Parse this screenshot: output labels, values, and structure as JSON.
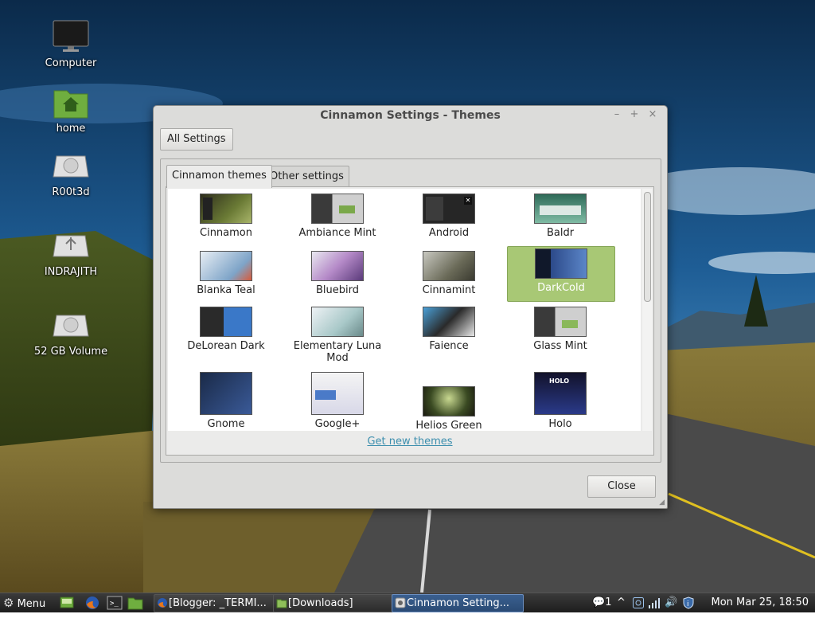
{
  "desktop": {
    "icons": [
      {
        "label": "Computer",
        "icon": "monitor-icon"
      },
      {
        "label": "home",
        "icon": "home-folder-icon"
      },
      {
        "label": "R00t3d",
        "icon": "drive-icon"
      },
      {
        "label": "INDRAJITH",
        "icon": "usb-drive-icon"
      },
      {
        "label": "52 GB Volume",
        "icon": "drive-icon"
      }
    ]
  },
  "window": {
    "title": "Cinnamon Settings - Themes",
    "all_settings_label": "All Settings",
    "tabs": [
      "Cinnamon themes",
      "Other settings"
    ],
    "themes": [
      "Cinnamon",
      "Ambiance Mint",
      "Android",
      "Baldr",
      "Blanka Teal",
      "Bluebird",
      "Cinnamint",
      "DarkCold",
      "DeLorean Dark",
      "Elementary Luna Mod",
      "Faience",
      "Glass Mint",
      "Gnome",
      "Google+",
      "Helios Green",
      "Holo"
    ],
    "selected_theme": "DarkCold",
    "get_new_link": "Get new themes",
    "close_label": "Close"
  },
  "taskbar": {
    "menu_label": "Menu",
    "tasks": [
      {
        "label": "[Blogger: _TERMI...",
        "icon": "firefox-icon",
        "active": false
      },
      {
        "label": "[Downloads]",
        "icon": "folder-icon",
        "active": false
      },
      {
        "label": "Cinnamon Setting...",
        "icon": "settings-icon",
        "active": true
      }
    ],
    "notification_count": "1",
    "clock": "Mon Mar 25, 18:50"
  },
  "colors": {
    "selection": "#a8c875",
    "link": "#3d8fae",
    "active_task": "#2a4a74"
  }
}
